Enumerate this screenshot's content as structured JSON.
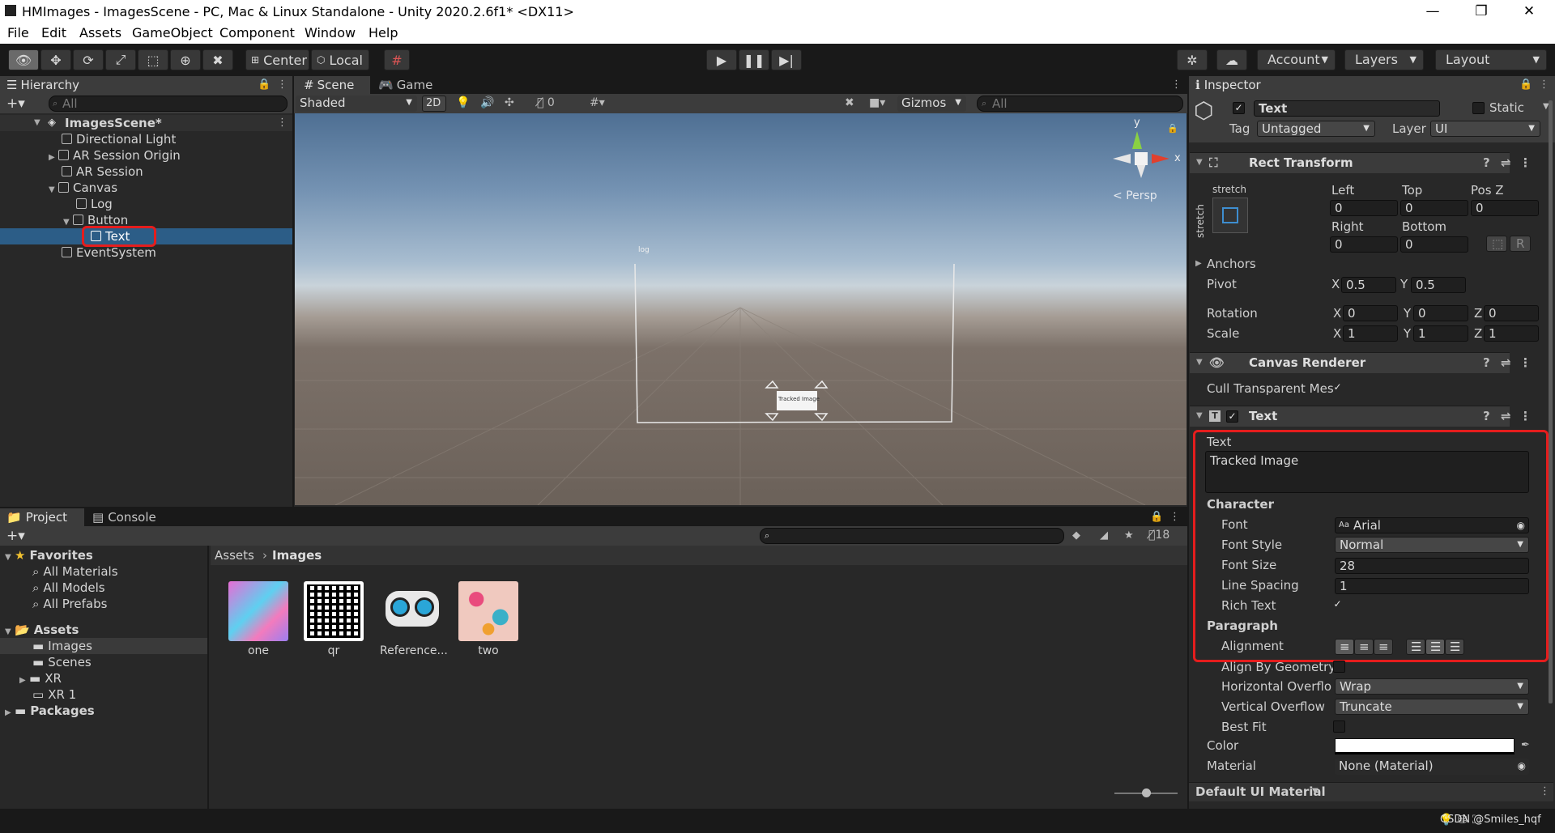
{
  "window": {
    "title": "HMImages - ImagesScene - PC, Mac & Linux Standalone - Unity 2020.2.6f1* <DX11>",
    "minimize": "—",
    "maximize": "❐",
    "close": "✕"
  },
  "menu": [
    "File",
    "Edit",
    "Assets",
    "GameObject",
    "Component",
    "Window",
    "Help"
  ],
  "toolbar": {
    "pivot_mode": "Center",
    "pivot_space": "Local",
    "account": "Account",
    "layers": "Layers",
    "layout": "Layout"
  },
  "hierarchy": {
    "tab": "Hierarchy",
    "search_placeholder": "All",
    "scene": "ImagesScene*",
    "items": [
      "Directional Light",
      "AR Session Origin",
      "AR Session",
      "Canvas",
      "Log",
      "Button",
      "Text",
      "EventSystem"
    ]
  },
  "scene_view": {
    "tabs": [
      "Scene",
      "Game"
    ],
    "shading": "Shaded",
    "mode_2d": "2D",
    "hidden_count": "0",
    "gizmos": "Gizmos",
    "search_placeholder": "All",
    "persp": "Persp",
    "axis_y": "y",
    "axis_x": "x",
    "world_log": "log",
    "world_button_text": "Tracked Image"
  },
  "project": {
    "tabs": [
      "Project",
      "Console"
    ],
    "hidden_count": "18",
    "breadcrumb": [
      "Assets",
      "Images"
    ],
    "favorites_label": "Favorites",
    "favorites": [
      "All Materials",
      "All Models",
      "All Prefabs"
    ],
    "assets_label": "Assets",
    "assets_children": [
      "Images",
      "Scenes",
      "XR",
      "XR 1"
    ],
    "packages_label": "Packages",
    "files": [
      "one",
      "qr",
      "Reference...",
      "two"
    ]
  },
  "inspector": {
    "tab": "Inspector",
    "object_name": "Text",
    "static_label": "Static",
    "tag_label": "Tag",
    "tag_value": "Untagged",
    "layer_label": "Layer",
    "layer_value": "UI",
    "rect_transform": {
      "title": "Rect Transform",
      "stretch_h": "stretch",
      "stretch_v": "stretch",
      "left_label": "Left",
      "left": "0",
      "top_label": "Top",
      "top": "0",
      "posz_label": "Pos Z",
      "posz": "0",
      "right_label": "Right",
      "right": "0",
      "bottom_label": "Bottom",
      "bottom": "0",
      "r_button": "R",
      "anchors": "Anchors",
      "pivot": "Pivot",
      "pivot_x": "0.5",
      "pivot_y": "0.5",
      "rotation": "Rotation",
      "rot_x": "0",
      "rot_y": "0",
      "rot_z": "0",
      "scale": "Scale",
      "scale_x": "1",
      "scale_y": "1",
      "scale_z": "1",
      "x": "X",
      "y": "Y",
      "z": "Z"
    },
    "canvas_renderer": {
      "title": "Canvas Renderer",
      "cull": "Cull Transparent Mes"
    },
    "text": {
      "title": "Text",
      "text_label": "Text",
      "text_value": "Tracked Image",
      "character": "Character",
      "font_label": "Font",
      "font_value": "Arial",
      "font_style_label": "Font Style",
      "font_style_value": "Normal",
      "font_size_label": "Font Size",
      "font_size_value": "28",
      "line_spacing_label": "Line Spacing",
      "line_spacing_value": "1",
      "rich_text_label": "Rich Text",
      "paragraph": "Paragraph",
      "alignment_label": "Alignment",
      "align_geometry_label": "Align By Geometry",
      "h_overflow_label": "Horizontal Overflo",
      "h_overflow_value": "Wrap",
      "v_overflow_label": "Vertical Overflow",
      "v_overflow_value": "Truncate",
      "best_fit_label": "Best Fit",
      "color_label": "Color",
      "material_label": "Material",
      "material_value": "None (Material)"
    },
    "default_material": "Default UI Material"
  },
  "statusbar": {
    "watermark": "CSDN @Smiles_hqf"
  }
}
